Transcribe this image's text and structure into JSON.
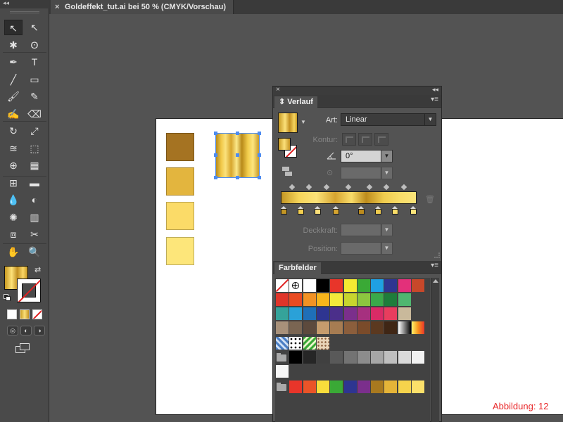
{
  "document_tab": {
    "title": "Goldeffekt_tut.ai bei 50 % (CMYK/Vorschau)",
    "close_glyph": "×"
  },
  "toolbar": {
    "collapse_glyph": "◂◂",
    "tools": [
      {
        "name": "selection-tool",
        "glyph": "↖",
        "active": true
      },
      {
        "name": "direct-selection-tool",
        "glyph": "↖"
      },
      {
        "name": "magic-wand-tool",
        "glyph": "✱"
      },
      {
        "name": "lasso-tool",
        "glyph": "ʘ"
      },
      {
        "name": "pen-tool",
        "glyph": "✒"
      },
      {
        "name": "type-tool",
        "glyph": "T"
      },
      {
        "name": "line-segment-tool",
        "glyph": "╱"
      },
      {
        "name": "rectangle-tool",
        "glyph": "▭"
      },
      {
        "name": "paintbrush-tool",
        "glyph": "🖌"
      },
      {
        "name": "pencil-tool",
        "glyph": "✎"
      },
      {
        "name": "blob-brush-tool",
        "glyph": "✍"
      },
      {
        "name": "eraser-tool",
        "glyph": "⌫"
      },
      {
        "name": "rotate-tool",
        "glyph": "↻"
      },
      {
        "name": "scale-tool",
        "glyph": "⤢"
      },
      {
        "name": "width-tool",
        "glyph": "≋"
      },
      {
        "name": "free-transform-tool",
        "glyph": "⬚"
      },
      {
        "name": "shape-builder-tool",
        "glyph": "⊕"
      },
      {
        "name": "perspective-grid-tool",
        "glyph": "▦"
      },
      {
        "name": "mesh-tool",
        "glyph": "⊞"
      },
      {
        "name": "gradient-tool",
        "glyph": "▬"
      },
      {
        "name": "eyedropper-tool",
        "glyph": "💧"
      },
      {
        "name": "blend-tool",
        "glyph": "◐"
      },
      {
        "name": "symbol-sprayer-tool",
        "glyph": "✺"
      },
      {
        "name": "column-graph-tool",
        "glyph": "▥"
      },
      {
        "name": "artboard-tool",
        "glyph": "⧈"
      },
      {
        "name": "slice-tool",
        "glyph": "✂"
      },
      {
        "name": "hand-tool",
        "glyph": "✋"
      },
      {
        "name": "zoom-tool",
        "glyph": "🔍"
      }
    ],
    "swap_glyph": "⇄"
  },
  "gradient_panel": {
    "collapse_glyph": "◂◂",
    "close_glyph": "×",
    "tab_label": "Verlauf",
    "menu_glyph": "▾≡",
    "type_label": "Art:",
    "type_value": "Linear",
    "stroke_label": "Kontur:",
    "angle_value": "0°",
    "aspect_value": "",
    "opacity_label": "Deckkraft:",
    "opacity_value": "",
    "position_label": "Position:",
    "position_value": "",
    "dropdown_glyph": "▼",
    "stops": [
      {
        "color": "#c39624"
      },
      {
        "color": "#f3cf4f"
      },
      {
        "color": "#fbe079"
      },
      {
        "color": "#d5a430"
      },
      {
        "color": "#bd8c1d"
      },
      {
        "color": "#f0cc4e"
      },
      {
        "color": "#f9dd68"
      },
      {
        "color": "#fbe57a"
      }
    ]
  },
  "swatches_panel": {
    "tab_label": "Farbfelder",
    "menu_glyph": "▾≡",
    "rows": [
      [
        "none",
        "registration",
        "#ffffff",
        "#000000",
        "#e8352a",
        "#f5ea32",
        "#3aa936",
        "#1fa0e2",
        "#2e3591",
        "#e3307a",
        "#c8482a"
      ],
      [
        "#e0352a",
        "#ea4b22",
        "#f29224",
        "#f7b51b",
        "#f3e93a",
        "#c7d52e",
        "#8cc63f",
        "#3aa94a",
        "#1e7d3b",
        "#4fb770"
      ],
      [
        "#35a39a",
        "#2aa1d8",
        "#1f6fb8",
        "#2e3591",
        "#4b2f8a",
        "#7b2f8c",
        "#a6307f",
        "#d92b66",
        "#e83d5e",
        "#c9b99b"
      ],
      [
        "#a8917a",
        "#7a6552",
        "#5d4a3d",
        "#c69c6d",
        "#a67c52",
        "#8b5e3c",
        "#7a4b2a",
        "#5b3920",
        "#3f2615",
        "gradient-bw",
        "gradient-orange"
      ],
      [
        "pattern-blue",
        "pattern-dots",
        "pattern-green",
        "pattern-brown"
      ],
      [
        "folder",
        "#000000",
        "#262626",
        "#404040",
        "#595959",
        "#737373",
        "#8c8c8c",
        "#a6a6a6",
        "#bfbfbf",
        "#d9d9d9",
        "#f2f2f2"
      ],
      [
        "#f7f7f7"
      ],
      [
        "folder",
        "#e8352a",
        "#ea5428",
        "#f9dc3b",
        "#3aa936",
        "#2e3591",
        "#7b2f8c",
        "#a8791f",
        "#e5b438",
        "#f5d34c",
        "#fbe06a"
      ]
    ]
  },
  "artboard": {
    "swatch_squares": [
      "#a57322",
      "#e3b53e",
      "#fbdb68",
      "#fde67a"
    ]
  },
  "figure_label": "Abbildung: 12"
}
